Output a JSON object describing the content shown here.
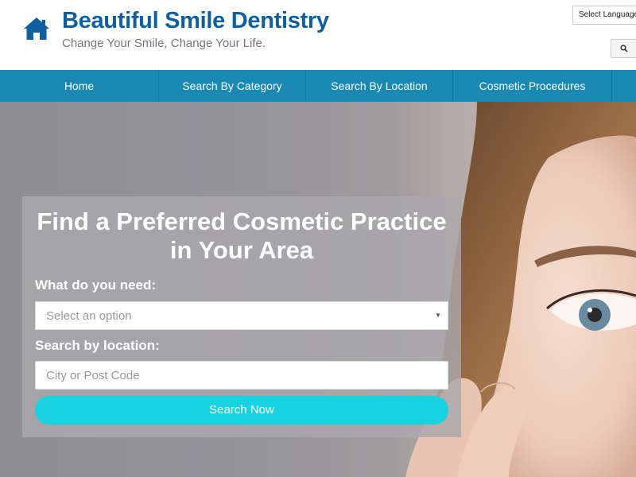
{
  "header": {
    "site_title": "Beautiful Smile Dentistry",
    "tagline": "Change Your Smile, Change Your Life.",
    "language_select": "Select Language",
    "logo_icon": "home-icon",
    "search_icon": "search-icon"
  },
  "nav": {
    "items": [
      {
        "label": "Home"
      },
      {
        "label": "Search By Category"
      },
      {
        "label": "Search By Location"
      },
      {
        "label": "Cosmetic Procedures"
      }
    ]
  },
  "hero": {
    "title_line1": "Find a Preferred Cosmetic Practice",
    "title_line2": "in Your Area",
    "need_label": "What do you need:",
    "need_select_value": "Select an option",
    "location_label": "Search by location:",
    "location_placeholder": "City or Post Code",
    "location_value": "",
    "submit_label": "Search Now"
  },
  "colors": {
    "brand_blue": "#0e5fa0",
    "nav_bg": "#1a8ab4",
    "button_cyan": "#16d3df"
  }
}
